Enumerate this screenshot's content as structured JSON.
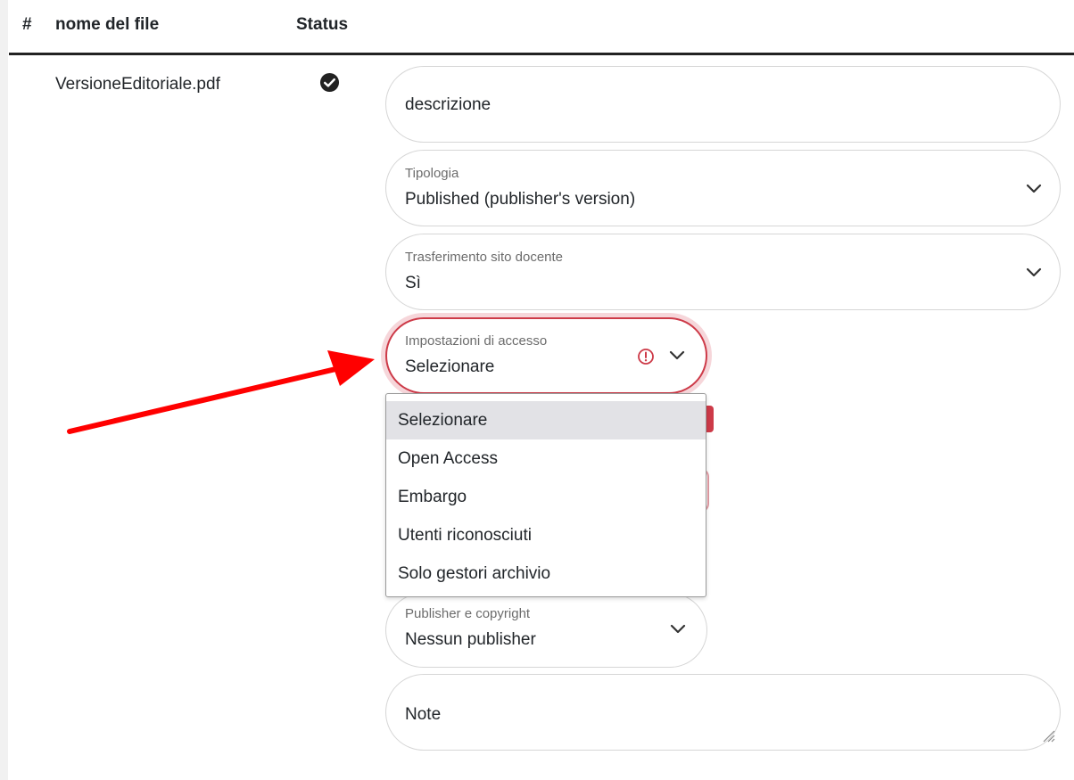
{
  "table": {
    "columns": {
      "index": "#",
      "filename": "nome del file",
      "status": "Status"
    },
    "row": {
      "filename": "VersioneEditoriale.pdf",
      "status_icon": "check-circle-icon"
    }
  },
  "form": {
    "descrizione": {
      "placeholder": "descrizione"
    },
    "tipologia": {
      "label": "Tipologia",
      "value": "Published (publisher's version)"
    },
    "trasferimento": {
      "label": "Trasferimento sito docente",
      "value": "Sì"
    },
    "accesso": {
      "label": "Impostazioni di accesso",
      "value": "Selezionare",
      "error_icon": "exclamation-circle-icon",
      "options": [
        "Selezionare",
        "Open Access",
        "Embargo",
        "Utenti riconosciuti",
        "Solo gestori archivio"
      ],
      "selected_option": "Selezionare"
    },
    "publisher": {
      "label": "Publisher e copyright",
      "value": "Nessun publisher"
    },
    "note": {
      "placeholder": "Note"
    }
  },
  "colors": {
    "error": "#cd3a48",
    "annotation_arrow": "#ff0000"
  }
}
